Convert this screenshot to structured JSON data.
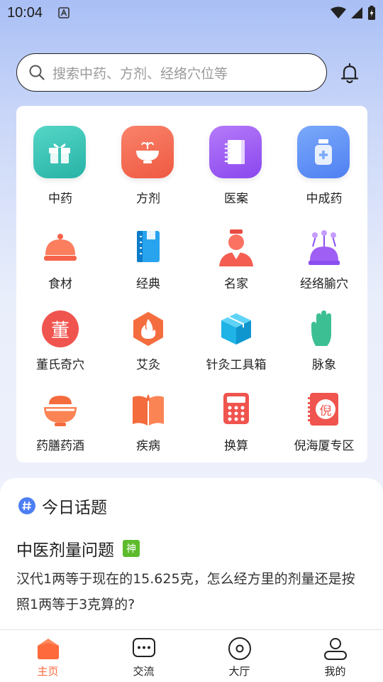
{
  "status_bar": {
    "time": "10:04",
    "icons": [
      "notification-a-icon",
      "wifi-icon",
      "signal-icon",
      "battery-icon"
    ]
  },
  "search": {
    "placeholder": "搜索中药、方剂、经络穴位等",
    "icon": "search-icon",
    "bell_icon": "bell-icon"
  },
  "grid": {
    "items": [
      {
        "label": "中药",
        "icon": "gift-box-icon",
        "color": "#36c3b4"
      },
      {
        "label": "方剂",
        "icon": "mortar-bowl-icon",
        "color": "#f46b51"
      },
      {
        "label": "医案",
        "icon": "notebook-icon",
        "color": "#9b5cf2"
      },
      {
        "label": "中成药",
        "icon": "medicine-bottle-icon",
        "color": "#5a8ff5"
      },
      {
        "label": "食材",
        "icon": "food-cover-icon",
        "color": "#f5644a"
      },
      {
        "label": "经典",
        "icon": "book-icon",
        "color": "#1d94e0"
      },
      {
        "label": "名家",
        "icon": "scholar-icon",
        "color": "#f45d52"
      },
      {
        "label": "经络腧穴",
        "icon": "acupoint-pins-icon",
        "color": "#8a4ef0"
      },
      {
        "label": "董氏奇穴",
        "icon": "dong-badge-icon",
        "color": "#f0544e",
        "glyph": "董"
      },
      {
        "label": "艾灸",
        "icon": "flame-icon",
        "color": "#f46d3e"
      },
      {
        "label": "针灸工具箱",
        "icon": "toolbox-icon",
        "color": "#1fb3e6"
      },
      {
        "label": "脉象",
        "icon": "hand-icon",
        "color": "#3dbf94"
      },
      {
        "label": "药膳药酒",
        "icon": "food-bowl-icon",
        "color": "#f46b3e"
      },
      {
        "label": "疾病",
        "icon": "open-book-icon",
        "color": "#f46b3e"
      },
      {
        "label": "换算",
        "icon": "calculator-icon",
        "color": "#f0544e"
      },
      {
        "label": "倪海厦专区",
        "icon": "ni-notebook-icon",
        "color": "#f0544e",
        "glyph": "倪"
      }
    ]
  },
  "topic": {
    "header_icon": "hashtag-icon",
    "header_title": "今日话题",
    "title": "中医剂量问题",
    "badge": "神",
    "body": "汉代1两等于现在的15.625克，怎么经方里的剂量还是按照1两等于3克算的?"
  },
  "bottom_nav": {
    "items": [
      {
        "label": "主页",
        "icon": "home-icon",
        "active": true
      },
      {
        "label": "交流",
        "icon": "chat-icon",
        "active": false
      },
      {
        "label": "大厅",
        "icon": "hall-icon",
        "active": false
      },
      {
        "label": "我的",
        "icon": "profile-icon",
        "active": false
      }
    ]
  },
  "colors": {
    "accent": "#ff6a3d",
    "badge": "#5dbb2c"
  }
}
